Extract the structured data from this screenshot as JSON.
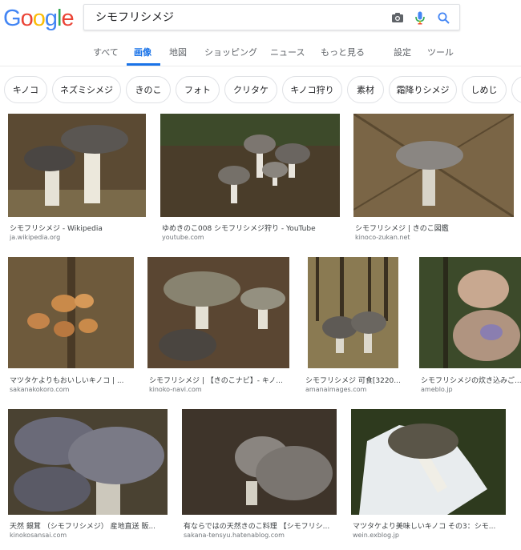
{
  "logo": {
    "letters": [
      "G",
      "o",
      "o",
      "g",
      "l",
      "e"
    ],
    "colors": [
      "#4285f4",
      "#ea4335",
      "#fbbc05",
      "#4285f4",
      "#34a853",
      "#ea4335"
    ]
  },
  "search": {
    "query": "シモフリシメジ",
    "icons": [
      "camera-icon",
      "mic-icon",
      "search-icon"
    ]
  },
  "nav": {
    "tabs": [
      "すべて",
      "画像",
      "地図",
      "ショッピング",
      "ニュース",
      "もっと見る"
    ],
    "active": "画像",
    "settings": "設定",
    "tools": "ツール"
  },
  "chips": [
    "キノコ",
    "ネズミシメジ",
    "きのこ",
    "フォト",
    "クリタケ",
    "キノコ狩り",
    "素材",
    "霜降りシメジ",
    "しめじ"
  ],
  "results": [
    {
      "title": "シモフリシメジ - Wikipedia",
      "source": "ja.wikipedia.org"
    },
    {
      "title": "ゆめきのこ008 シモフリシメジ狩り - YouTube",
      "source": "youtube.com"
    },
    {
      "title": "シモフリシメジ | きのこ図鑑",
      "source": "kinoco-zukan.net"
    },
    {
      "title": "マツタケよりもおいしいキノコ | ...",
      "source": "sakanakokoro.com"
    },
    {
      "title": "シモフリシメジ | 【きのこナビ】- キノ...",
      "source": "kinoko-navi.com"
    },
    {
      "title": "シモフリシメジ 可食[3220...",
      "source": "amanaimages.com"
    },
    {
      "title": "シモフリシメジの炊き込みご...",
      "source": "ameblo.jp"
    },
    {
      "title": "天然 銀茸 （シモフリシメジ） 産地直送 販...",
      "source": "kinokosansai.com"
    },
    {
      "title": "有ならではの天然きのこ料理 【シモフリシ...",
      "source": "sakana-tensyu.hatenablog.com"
    },
    {
      "title": "マツタケより美味しいキノコ その3：シモ...",
      "source": "wein.exblog.jp"
    }
  ],
  "colors": {
    "accent": "#1a73e8",
    "text": "#202124",
    "muted": "#70757a"
  }
}
